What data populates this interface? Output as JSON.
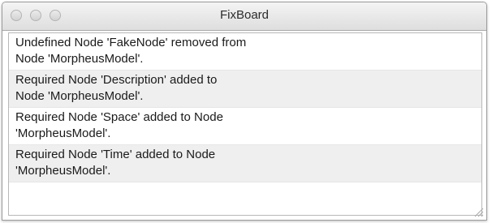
{
  "window": {
    "title": "FixBoard"
  },
  "messages": [
    {
      "text": "Undefined Node 'FakeNode' removed from\nNode 'MorpheusModel'."
    },
    {
      "text": "Required Node 'Description' added to\nNode 'MorpheusModel'."
    },
    {
      "text": "Required Node 'Space' added to Node\n'MorpheusModel'."
    },
    {
      "text": "Required Node 'Time' added to Node\n'MorpheusModel'."
    }
  ]
}
